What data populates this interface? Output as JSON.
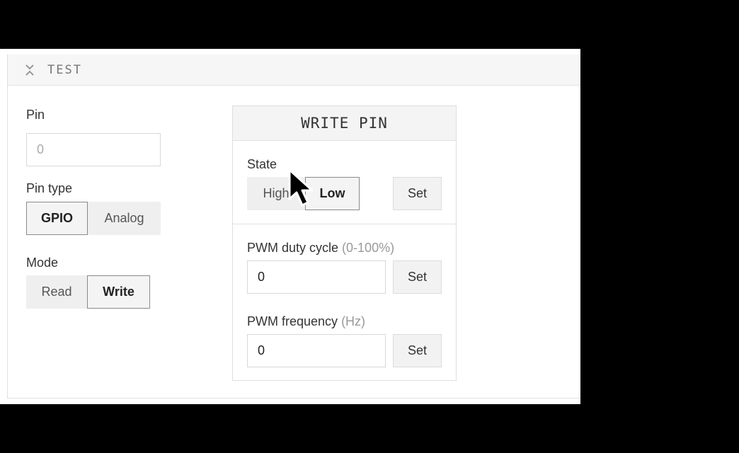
{
  "section": {
    "title": "TEST",
    "collapse_icon": "chevrons-collapse-icon"
  },
  "pin": {
    "label": "Pin",
    "placeholder": "0"
  },
  "pin_type": {
    "label": "Pin type",
    "options": [
      "GPIO",
      "Analog"
    ],
    "selected": "GPIO"
  },
  "mode": {
    "label": "Mode",
    "options": [
      "Read",
      "Write"
    ],
    "selected": "Write"
  },
  "write_pin": {
    "title": "WRITE PIN",
    "state": {
      "label": "State",
      "options": [
        "High",
        "Low"
      ],
      "selected": "Low",
      "set_label": "Set"
    },
    "pwm_duty": {
      "label": "PWM duty cycle",
      "unit": "(0-100%)",
      "value": "0",
      "set_label": "Set"
    },
    "pwm_freq": {
      "label": "PWM frequency",
      "unit": "(Hz)",
      "value": "0",
      "set_label": "Set"
    }
  },
  "colors": {
    "background": "#000000",
    "panel": "#ffffff",
    "header": "#f6f6f6",
    "selected_border": "#8a8a8a"
  }
}
